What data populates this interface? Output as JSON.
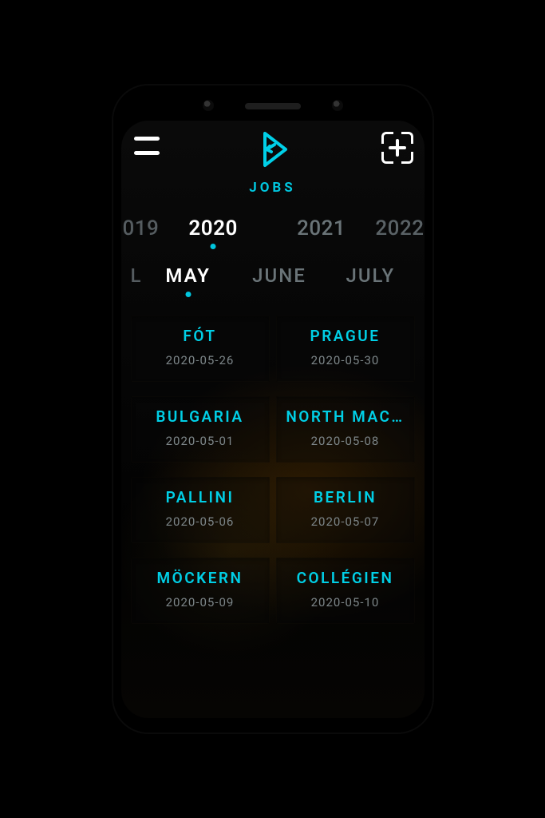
{
  "header": {
    "title": "JOBS"
  },
  "years": {
    "edge_left": "019",
    "items": [
      "2020",
      "2021",
      "2022"
    ],
    "selected_index": 0
  },
  "months": {
    "edge_left": "L",
    "items": [
      "MAY",
      "JUNE",
      "JULY"
    ],
    "selected_index": 0
  },
  "jobs": [
    {
      "name": "FÓT",
      "date": "2020-05-26"
    },
    {
      "name": "PRAGUE",
      "date": "2020-05-30"
    },
    {
      "name": "BULGARIA",
      "date": "2020-05-01"
    },
    {
      "name": "NORTH MAC…",
      "date": "2020-05-08"
    },
    {
      "name": "PALLINI",
      "date": "2020-05-06"
    },
    {
      "name": "BERLIN",
      "date": "2020-05-07"
    },
    {
      "name": "MÖCKERN",
      "date": "2020-05-09"
    },
    {
      "name": "COLLÉGIEN",
      "date": "2020-05-10"
    }
  ],
  "colors": {
    "accent": "#00cfe6",
    "muted": "#6a7478"
  }
}
